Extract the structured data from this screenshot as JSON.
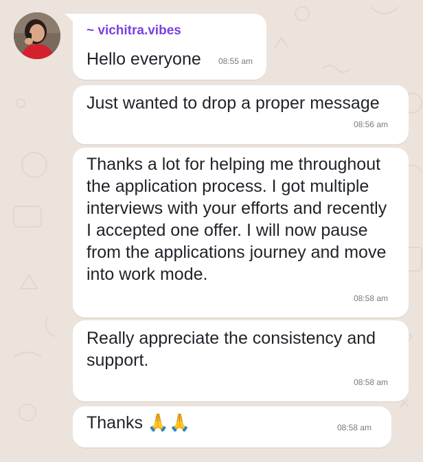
{
  "chat": {
    "sender_name": "~ vichitra.vibes",
    "messages": [
      {
        "text": "Hello everyone",
        "time": "08:55 am"
      },
      {
        "text": "Just wanted to drop a proper message",
        "time": "08:56 am"
      },
      {
        "text": "Thanks a lot for helping me throughout\nthe application process. I got multiple\ninterviews with your efforts and recently\nI accepted one offer. I will now pause\nfrom the applications journey and move\ninto work mode.",
        "time": "08:58 am"
      },
      {
        "text": "Really appreciate the consistency and\nsupport.",
        "time": "08:58 am"
      },
      {
        "text": "Thanks 🙏🙏",
        "time": "08:58 am"
      }
    ]
  },
  "icons": {
    "avatar": "user-avatar",
    "tail": "bubble-tail-icon"
  },
  "colors": {
    "wallpaper": "#ece4dc",
    "bubble": "#ffffff",
    "sender_name": "#7b3fe4",
    "text": "#1f2329",
    "timestamp": "#7a7a7a"
  }
}
